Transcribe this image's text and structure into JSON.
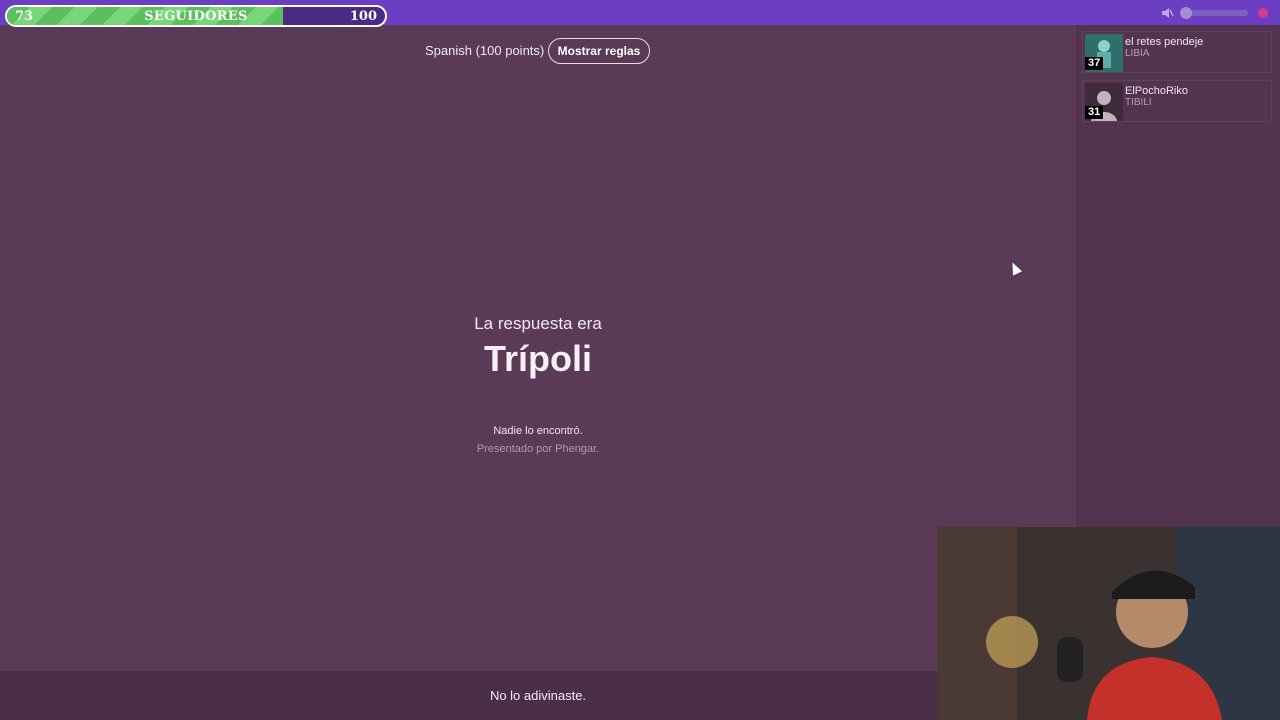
{
  "followers": {
    "current": "73",
    "label": "SEGUIDORES",
    "goal": "100",
    "progress": 0.73
  },
  "header": {
    "language": "Spanish (100 points)",
    "rules_button": "Mostrar reglas"
  },
  "answer": {
    "intro": "La respuesta era",
    "word": "Trípoli",
    "status": "Nadie lo encontró.",
    "credit": "Presentado por Phengar."
  },
  "players": [
    {
      "name": "el retes pendeje",
      "country": "LIBIA",
      "score": "37"
    },
    {
      "name": "ElPochoRiko",
      "country": "TIBILI",
      "score": "31"
    }
  ],
  "result": "No lo adivinaste.",
  "colors": {
    "topbar": "#6c3ec2",
    "background": "#5a3a56",
    "progress_fill": "#5bbf5b"
  },
  "icons": [
    "mute-icon",
    "volume-slider",
    "flag-icon"
  ]
}
